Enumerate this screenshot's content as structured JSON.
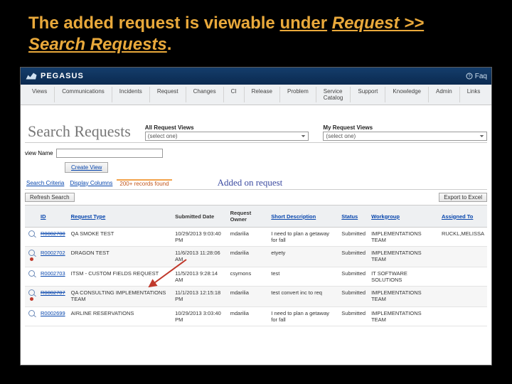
{
  "caption": {
    "prefix": "The added request is viewable ",
    "underlined": "under",
    "space": " ",
    "em1": "Request >> Search Requests",
    "suffix": "."
  },
  "topbar": {
    "brand": "PEGASUS",
    "faq": "Faq"
  },
  "menu": [
    "Views",
    "Communications",
    "Incidents",
    "Request",
    "Changes",
    "CI",
    "Release",
    "Problem",
    "Service Catalog",
    "Support",
    "Knowledge",
    "Admin",
    "Links"
  ],
  "page": {
    "title": "Search Requests"
  },
  "viewsHeader": {
    "all": {
      "label": "All Request Views",
      "value": "(select one)"
    },
    "my": {
      "label": "My Request Views",
      "value": "(select one)"
    }
  },
  "viewName": {
    "label": "view Name"
  },
  "buttons": {
    "createView": "Create View",
    "refresh": "Refresh Search",
    "export": "Export to Excel"
  },
  "tabs": {
    "criteria": "Search Criteria",
    "columns": "Display Columns",
    "countText": "200+ records found"
  },
  "annotation": "Added on request",
  "columns": [
    "",
    "ID",
    "Request Type",
    "Submitted Date",
    "Request Owner",
    "Short Description",
    "Status",
    "Workgroup",
    "Assigned To"
  ],
  "rows": [
    {
      "id": "R0002700",
      "idStruck": true,
      "warn": false,
      "type": "QA SMOKE TEST",
      "date": "10/29/2013 9:03:40 PM",
      "owner": "mdarilia",
      "desc": "I need to plan a getaway for fall",
      "status": "Submitted",
      "wg": "IMPLEMENTATIONS TEAM",
      "assigned": "RUCKL,MELISSA"
    },
    {
      "id": "R0002702",
      "idStruck": false,
      "warn": true,
      "type": "DRAGON TEST",
      "date": "11/6/2013 11:28:06 AM",
      "owner": "mdarilia",
      "desc": "etyety",
      "status": "Submitted",
      "wg": "IMPLEMENTATIONS TEAM",
      "assigned": ""
    },
    {
      "id": "R0002703",
      "idStruck": false,
      "warn": false,
      "type": "ITSM - CUSTOM FIELDS REQUEST",
      "date": "11/5/2013 9:28:14 AM",
      "owner": "csymons",
      "desc": "test",
      "status": "Submitted",
      "wg": "IT SOFTWARE SOLUTIONS",
      "assigned": ""
    },
    {
      "id": "R0002707",
      "idStruck": true,
      "warn": true,
      "type": "QA CONSULTING IMPLEMENTATIONS TEAM",
      "date": "11/1/2013 12:15:18 PM",
      "owner": "mdarilia",
      "desc": "test convert inc to req",
      "status": "Submitted",
      "wg": "IMPLEMENTATIONS TEAM",
      "assigned": ""
    },
    {
      "id": "R0002699",
      "idStruck": false,
      "warn": false,
      "type": "AIRLINE RESERVATIONS",
      "date": "10/29/2013 3:03:40 PM",
      "owner": "mdarilia",
      "desc": "I need to plan a getaway for fall",
      "status": "Submitted",
      "wg": "IMPLEMENTATIONS TEAM",
      "assigned": ""
    }
  ]
}
